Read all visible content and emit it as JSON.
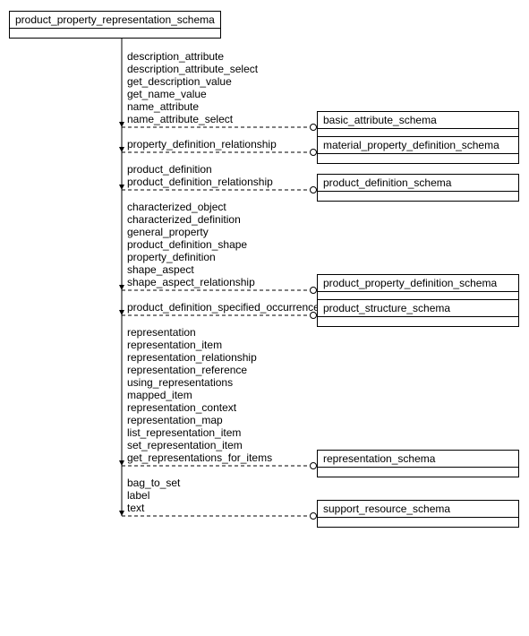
{
  "main_schema": "product_property_representation_schema",
  "groups": [
    {
      "items": [
        "description_attribute",
        "description_attribute_select",
        "get_description_value",
        "get_name_value",
        "name_attribute",
        "name_attribute_select"
      ],
      "target": "basic_attribute_schema"
    },
    {
      "items": [
        "property_definition_relationship"
      ],
      "target": "material_property_definition_schema"
    },
    {
      "items": [
        "product_definition",
        "product_definition_relationship"
      ],
      "target": "product_definition_schema"
    },
    {
      "items": [
        "characterized_object",
        "characterized_definition",
        "general_property",
        "product_definition_shape",
        "property_definition",
        "shape_aspect",
        "shape_aspect_relationship"
      ],
      "target": "product_property_definition_schema"
    },
    {
      "items": [
        "product_definition_specified_occurrence"
      ],
      "target": "product_structure_schema"
    },
    {
      "items": [
        "representation",
        "representation_item",
        "representation_relationship",
        "representation_reference",
        "using_representations",
        "mapped_item",
        "representation_context",
        "representation_map",
        "list_representation_item",
        "set_representation_item",
        "get_representations_for_items"
      ],
      "target": "representation_schema"
    },
    {
      "items": [
        "bag_to_set",
        "label",
        "text"
      ],
      "target": "support_resource_schema"
    }
  ]
}
